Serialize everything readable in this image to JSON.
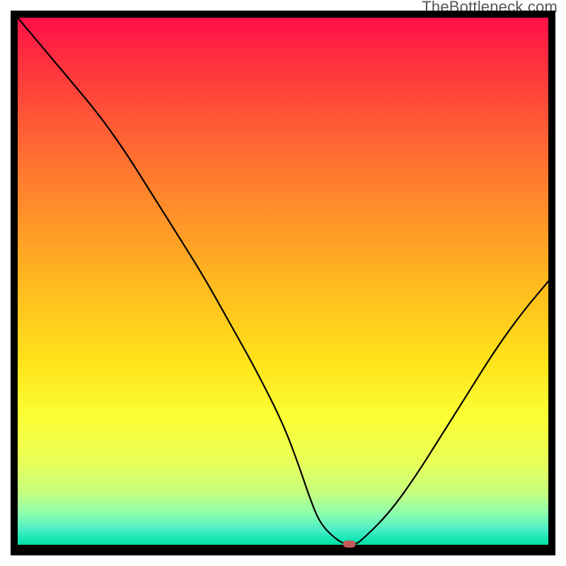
{
  "watermark": "TheBottleneck.com",
  "chart_data": {
    "type": "line",
    "title": "",
    "xlabel": "",
    "ylabel": "",
    "xlim": [
      0,
      100
    ],
    "ylim": [
      0,
      100
    ],
    "x": [
      0,
      5,
      10,
      15,
      20,
      25,
      30,
      35,
      40,
      45,
      50,
      53,
      55,
      57,
      60,
      62,
      63.5,
      65,
      70,
      75,
      80,
      85,
      90,
      95,
      100
    ],
    "values": [
      100,
      94,
      88,
      82,
      75,
      67,
      59,
      51,
      42,
      33,
      23,
      15,
      9,
      4,
      1,
      0,
      0,
      1,
      6,
      13,
      21,
      29,
      37,
      44,
      50
    ],
    "marker": {
      "x": 62.5,
      "y": 0
    },
    "grid": false
  }
}
